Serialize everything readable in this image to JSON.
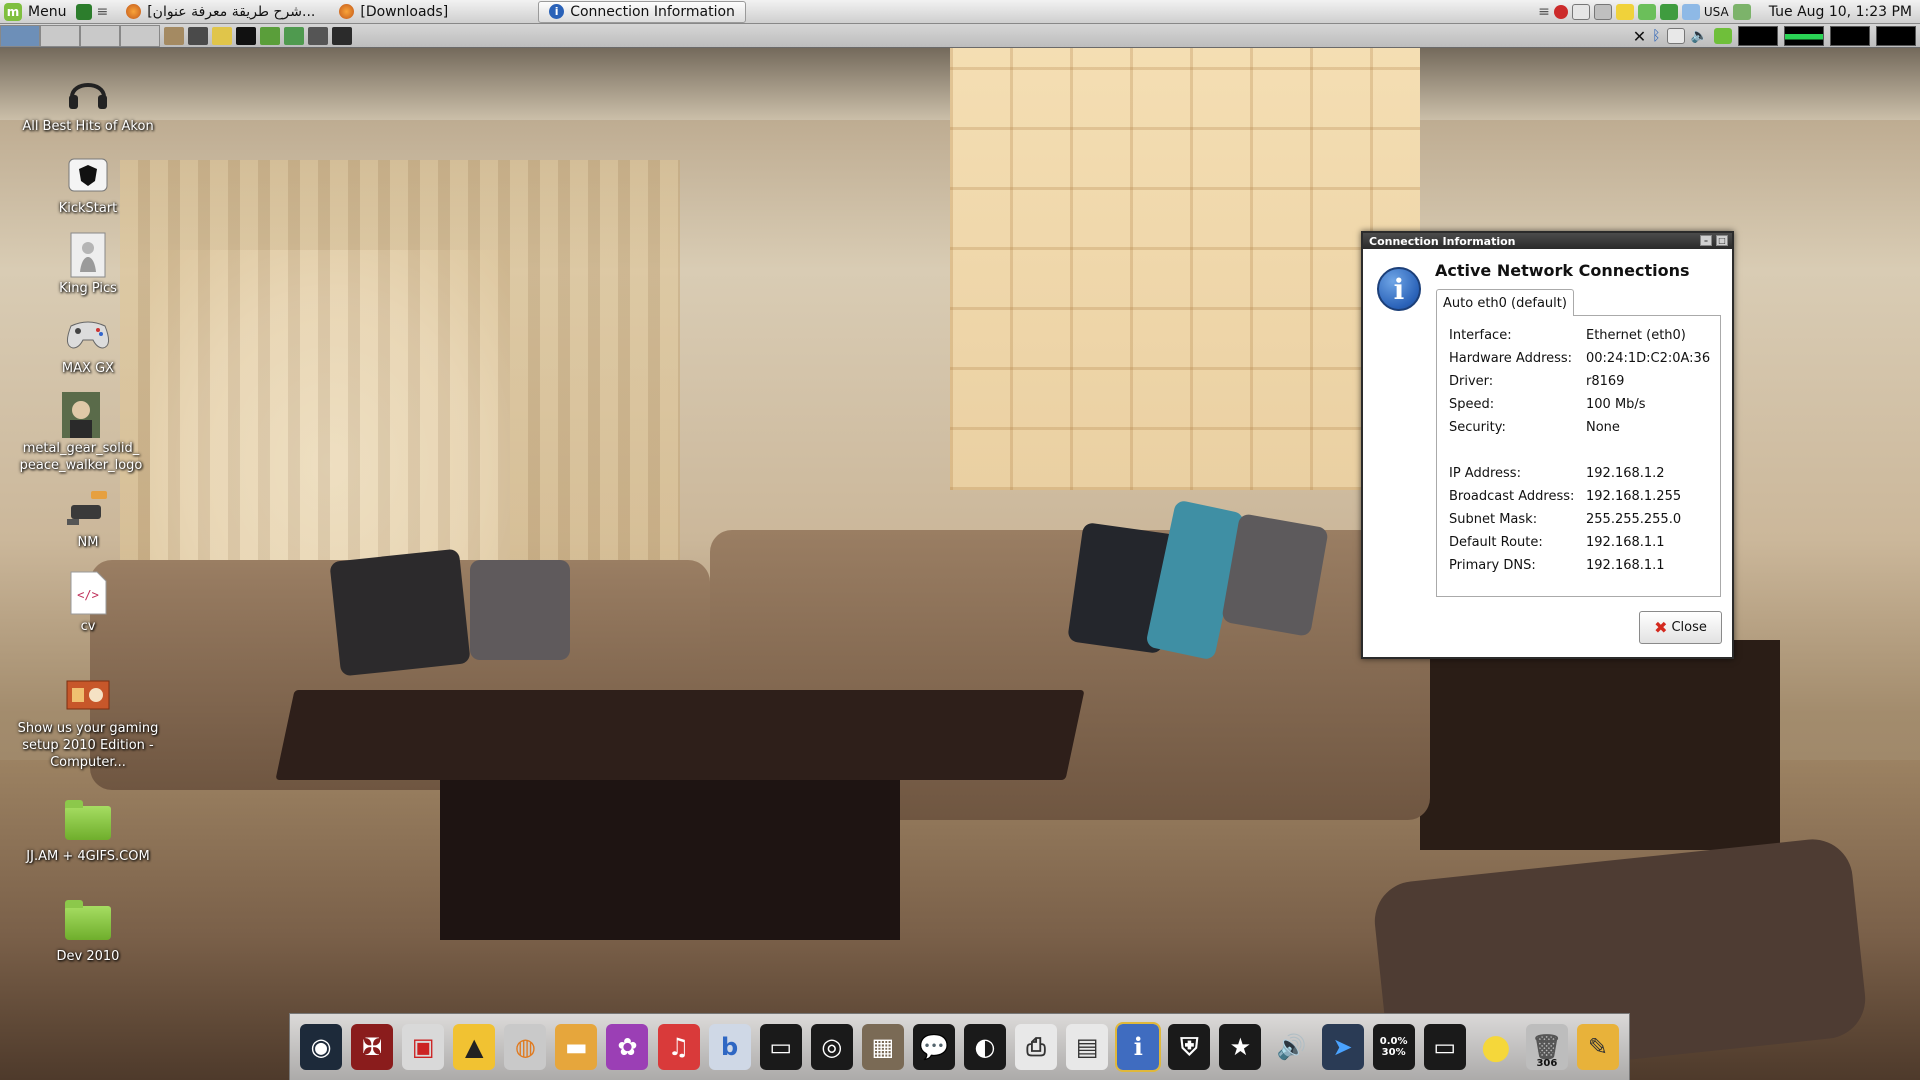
{
  "top_panel": {
    "menu_label": "Menu",
    "tasks": [
      {
        "label": "[شرح طريقة معرفة عنوان...",
        "active": false
      },
      {
        "label": "[Downloads]",
        "active": false
      },
      {
        "label": "Connection Information",
        "active": true
      }
    ],
    "tray_locale": "USA",
    "clock": "Tue Aug 10,  1:23 PM"
  },
  "desktop_icons": [
    {
      "label": "All Best Hits of Akon",
      "icon": "headphones-icon"
    },
    {
      "label": "KickStart",
      "icon": "shield-icon"
    },
    {
      "label": "King Pics",
      "icon": "picture-icon"
    },
    {
      "label": "MAX GX",
      "icon": "gamepad-icon"
    },
    {
      "label": "metal_gear_solid_\npeace_walker_logo",
      "icon": "image-thumbnail-icon"
    },
    {
      "label": "NM",
      "icon": "network-manager-icon"
    },
    {
      "label": "cv",
      "icon": "html-file-icon"
    },
    {
      "label": "Show us your gaming setup 2010 Edition - Computer...",
      "icon": "web-link-icon"
    },
    {
      "label": "JJ.AM + 4GIFS.COM",
      "icon": "folder-icon"
    },
    {
      "label": "Dev 2010",
      "icon": "folder-icon"
    }
  ],
  "dialog": {
    "title": "Connection Information",
    "heading": "Active Network Connections",
    "tab_label": "Auto eth0 (default)",
    "rows": [
      {
        "key": "Interface:",
        "value": "Ethernet (eth0)"
      },
      {
        "key": "Hardware Address:",
        "value": "00:24:1D:C2:0A:36"
      },
      {
        "key": "Driver:",
        "value": "r8169"
      },
      {
        "key": "Speed:",
        "value": "100 Mb/s"
      },
      {
        "key": "Security:",
        "value": "None"
      },
      {
        "key": "IP Address:",
        "value": "192.168.1.2"
      },
      {
        "key": "Broadcast Address:",
        "value": "192.168.1.255"
      },
      {
        "key": "Subnet Mask:",
        "value": "255.255.255.0"
      },
      {
        "key": "Default Route:",
        "value": "192.168.1.1"
      },
      {
        "key": "Primary DNS:",
        "value": "192.168.1.1"
      }
    ],
    "close_label": "Close"
  },
  "dock": {
    "cpu_readout_top": "0.0%",
    "cpu_readout_bottom": "30%",
    "trash_count": "306",
    "items": [
      "steam-icon",
      "gun-icon",
      "media-player-icon",
      "vlc-icon",
      "firefox-icon",
      "file-manager-icon",
      "gnome-flower-icon",
      "music-player-icon",
      "bittorrent-icon",
      "terminal-icon",
      "firefox-globe-icon",
      "remote-desktop-icon",
      "chat-icon",
      "gimp-icon",
      "printer-icon",
      "scanner-icon",
      "info-icon",
      "computer-icon",
      "favorites-icon",
      "volume-icon",
      "pointer-icon",
      "cpu-monitor-icon",
      "terminal-2-icon",
      "weather-icon",
      "trash-icon",
      "text-editor-icon"
    ]
  },
  "colors": {
    "panel_bg": "#d8d8d8",
    "dialog_titlebar": "#2a2a2a",
    "close_icon": "#d42a1f",
    "info_blue": "#2a62b8",
    "net_monitor": "#2ad455"
  }
}
